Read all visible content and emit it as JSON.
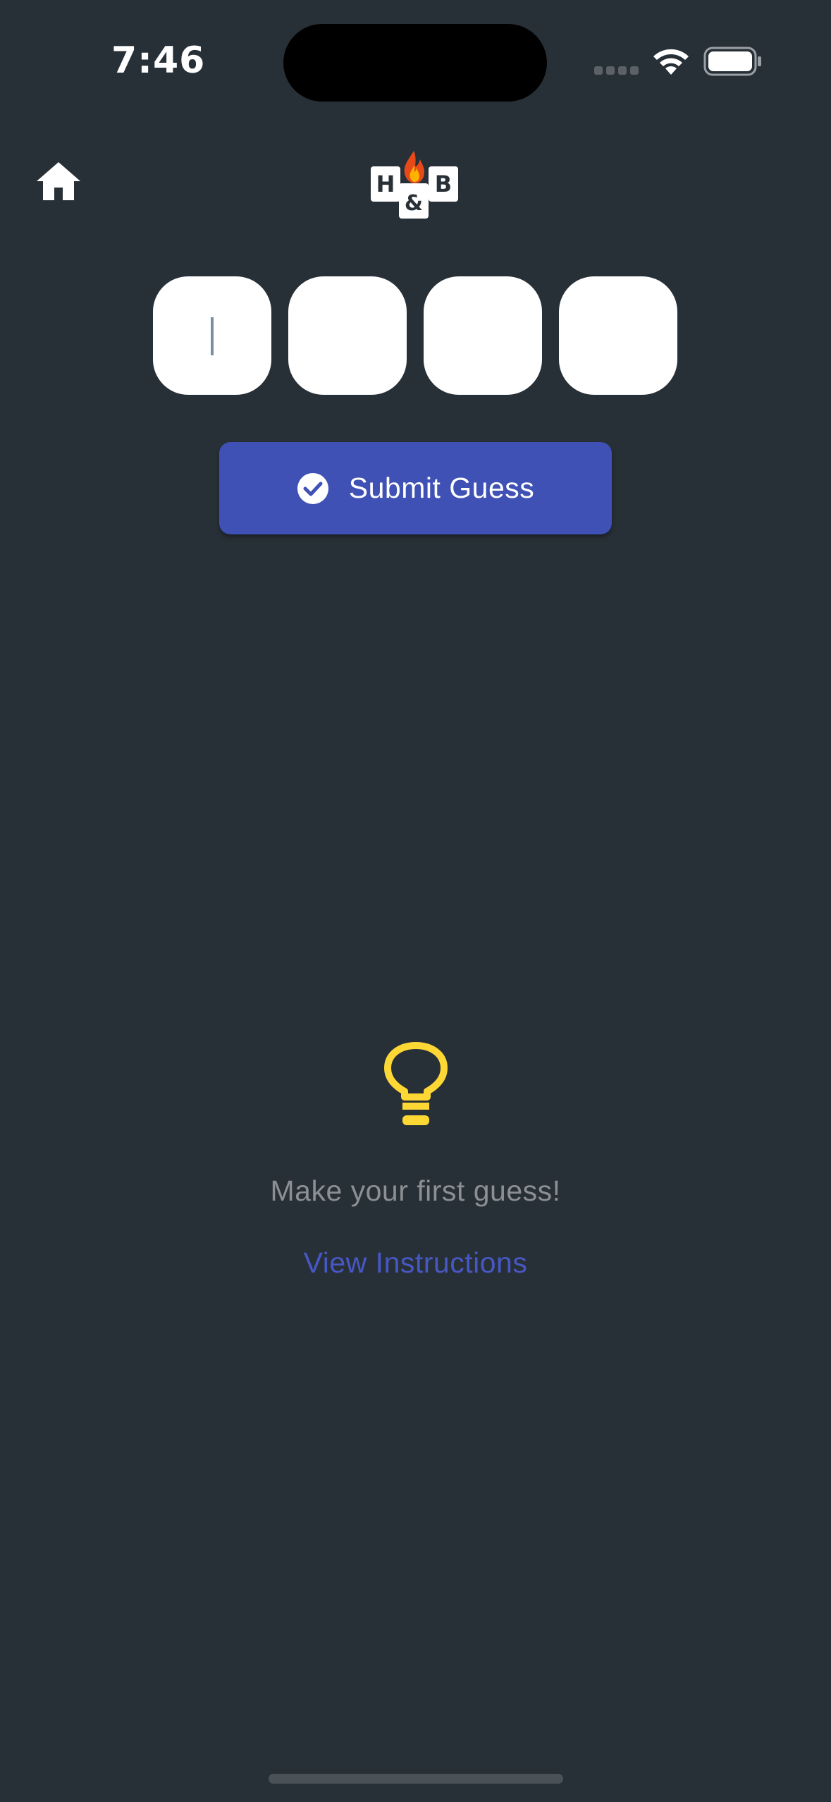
{
  "status_bar": {
    "time": "7:46"
  },
  "header": {
    "home_icon": "home-icon",
    "logo": {
      "letters": [
        "H",
        "&",
        "B"
      ],
      "icon": "fire-icon"
    }
  },
  "guess": {
    "digit_values": [
      "",
      "",
      "",
      ""
    ],
    "submit_label": "Submit Guess",
    "submit_icon": "check-circle-icon"
  },
  "empty_state": {
    "icon": "lightbulb-icon",
    "message": "Make your first guess!",
    "link_label": "View Instructions"
  },
  "colors": {
    "background": "#283037",
    "accent": "#3f51b5",
    "link": "#4757c4",
    "bulb": "#fdd835",
    "muted_text": "#8c8f93"
  }
}
